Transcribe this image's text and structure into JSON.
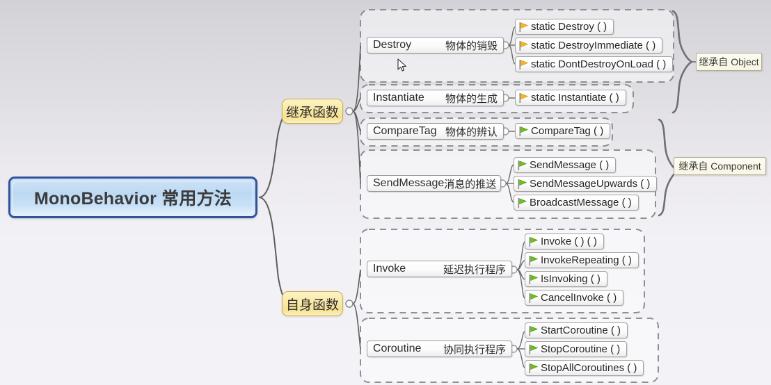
{
  "root": {
    "label": "MonoBehavior 常用方法"
  },
  "branches": [
    {
      "id": "inherited",
      "label": "继承函数"
    },
    {
      "id": "own",
      "label": "自身函数"
    }
  ],
  "groups": [
    {
      "id": "destroy",
      "topic": {
        "name": "Destroy",
        "desc": "物体的销毁"
      },
      "methods": [
        {
          "label": "static Destroy ( )",
          "flag": "yellow-flag-icon"
        },
        {
          "label": "static DestroyImmediate ( )",
          "flag": "yellow-flag-icon"
        },
        {
          "label": "static DontDestroyOnLoad ( )",
          "flag": "yellow-flag-icon"
        }
      ]
    },
    {
      "id": "instantiate",
      "topic": {
        "name": "Instantiate",
        "desc": "物体的生成"
      },
      "methods": [
        {
          "label": "static Instantiate ( )",
          "flag": "yellow-flag-icon"
        }
      ]
    },
    {
      "id": "comparetag",
      "topic": {
        "name": "CompareTag",
        "desc": "物体的辨认"
      },
      "methods": [
        {
          "label": "CompareTag ( )",
          "flag": "green-flag-icon"
        }
      ]
    },
    {
      "id": "sendmessage",
      "topic": {
        "name": "SendMessage",
        "desc": "消息的推送"
      },
      "methods": [
        {
          "label": "SendMessage ( )",
          "flag": "green-flag-icon"
        },
        {
          "label": "SendMessageUpwards ( )",
          "flag": "green-flag-icon"
        },
        {
          "label": "BroadcastMessage ( )",
          "flag": "green-flag-icon"
        }
      ]
    },
    {
      "id": "invoke",
      "topic": {
        "name": "Invoke",
        "desc": "延迟执行程序"
      },
      "methods": [
        {
          "label": "Invoke ( ) ( )",
          "flag": "green-flag-icon"
        },
        {
          "label": "InvokeRepeating ( )",
          "flag": "green-flag-icon"
        },
        {
          "label": "IsInvoking ( )",
          "flag": "green-flag-icon"
        },
        {
          "label": "CancelInvoke ( )",
          "flag": "green-flag-icon"
        }
      ]
    },
    {
      "id": "coroutine",
      "topic": {
        "name": "Coroutine",
        "desc": "协同执行程序"
      },
      "methods": [
        {
          "label": "StartCoroutine ( )",
          "flag": "green-flag-icon"
        },
        {
          "label": "StopCoroutine ( )",
          "flag": "green-flag-icon"
        },
        {
          "label": "StopAllCoroutines ( )",
          "flag": "green-flag-icon"
        }
      ]
    }
  ],
  "notes": [
    {
      "id": "note-object",
      "label": "继承自 Object"
    },
    {
      "id": "note-component",
      "label": "继承自 Component"
    }
  ],
  "colors": {
    "root_border": "#31539b",
    "root_fill": "#c3dcf5",
    "branch_border": "#c9ae5b",
    "branch_fill": "#f9e9a4",
    "group_dash": "#8f8f8f",
    "connector": "#6b6b6b",
    "flag_yellow": "#f5b91a",
    "flag_green": "#6cc019",
    "note_fill": "#f7f5e6"
  }
}
